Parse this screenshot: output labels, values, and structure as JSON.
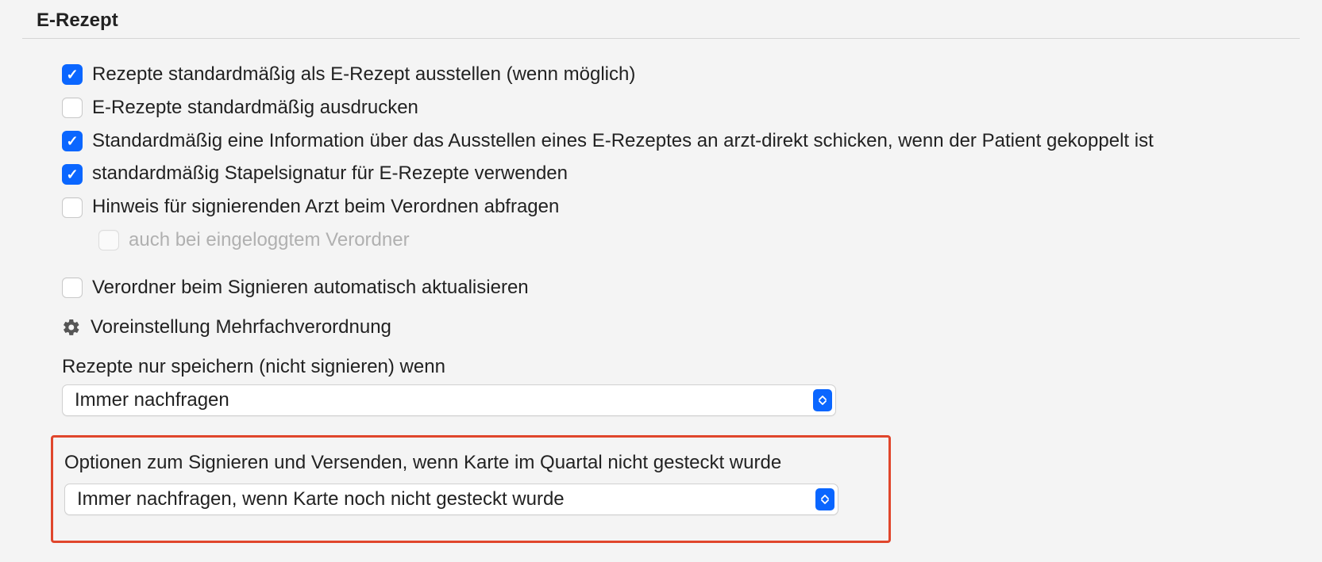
{
  "section": {
    "title": "E-Rezept"
  },
  "checkboxes": {
    "cb1": {
      "label": "Rezepte standardmäßig als E-Rezept ausstellen (wenn möglich)"
    },
    "cb2": {
      "label": "E-Rezepte standardmäßig ausdrucken"
    },
    "cb3": {
      "label": "Standardmäßig eine Information über das Ausstellen eines E-Rezeptes an arzt-direkt schicken, wenn der Patient gekoppelt ist"
    },
    "cb4": {
      "label": "standardmäßig Stapelsignatur für E-Rezepte verwenden"
    },
    "cb5": {
      "label": "Hinweis für signierenden Arzt beim Verordnen abfragen"
    },
    "cb5a": {
      "label": "auch bei eingeloggtem Verordner"
    },
    "cb6": {
      "label": "Verordner beim Signieren automatisch aktualisieren"
    }
  },
  "gear": {
    "label": "Voreinstellung Mehrfachverordnung"
  },
  "select1": {
    "label": "Rezepte nur speichern (nicht signieren) wenn",
    "value": "Immer nachfragen"
  },
  "select2": {
    "label": "Optionen zum Signieren und Versenden, wenn Karte im Quartal nicht gesteckt wurde",
    "value": "Immer nachfragen, wenn Karte noch nicht gesteckt wurde"
  }
}
